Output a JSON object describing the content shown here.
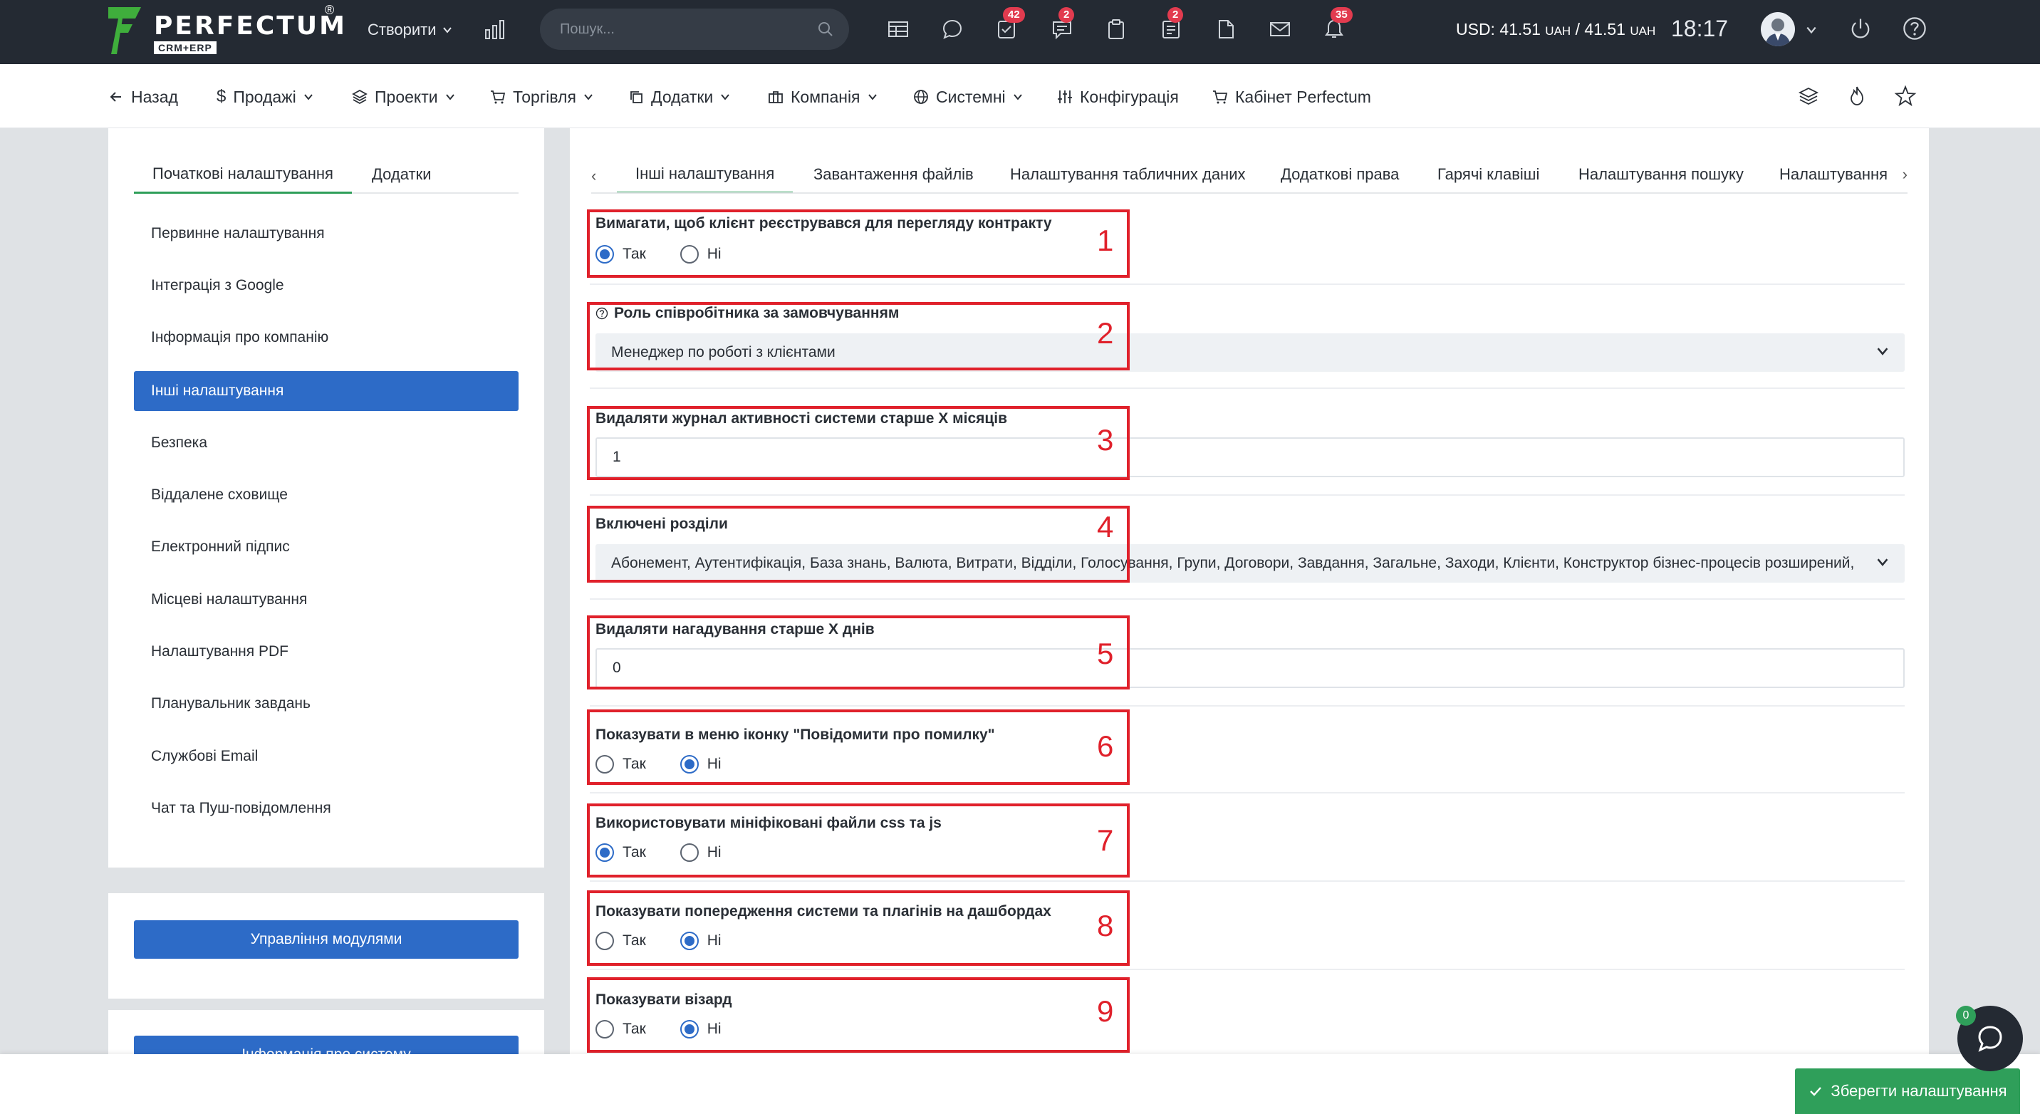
{
  "topbar": {
    "logo_text": "PERFECTUM",
    "logo_reg": "®",
    "logo_sub": "CRM+ERP",
    "create_label": "Створити",
    "search_placeholder": "Пошук...",
    "badges": {
      "tasks": "42",
      "chat": "2",
      "notes": "2",
      "notifications": "35"
    },
    "currency_usd": "USD: 41.51",
    "currency_unit1": "UAH",
    "currency_sep": " / 41.51",
    "currency_unit2": "UAH",
    "time": "18:17"
  },
  "nav2": {
    "back": "Назад",
    "sales": "Продажі",
    "projects": "Проекти",
    "trade": "Торгівля",
    "addons": "Додатки",
    "company": "Компанія",
    "system": "Системні",
    "config": "Конфігурація",
    "cabinet": "Кабінет Perfectum"
  },
  "left": {
    "tab_initial": "Початкові налаштування",
    "tab_addons": "Додатки",
    "items": [
      "Первинне налаштування",
      "Інтеграція з Google",
      "Інформація про компанію",
      "Інші налаштування",
      "Безпека",
      "Віддалене сховище",
      "Електронний підпис",
      "Місцеві налаштування",
      "Налаштування PDF",
      "Планувальник завдань",
      "Службові Email",
      "Чат та Пуш-повідомлення"
    ],
    "active_index": 3,
    "modules_button": "Управління модулями",
    "sysinfo_button": "Інформація про систему"
  },
  "right": {
    "tabs": [
      "Інші налаштування",
      "Завантаження файлів",
      "Налаштування табличних даних",
      "Додаткові права",
      "Гарячі клавіші",
      "Налаштування пошуку",
      "Налаштування"
    ],
    "yes": "Так",
    "no": "Ні",
    "f1_label": "Вимагати, щоб клієнт реєструвався для перегляду контракту",
    "f2_label": "Роль співробітника за замовчуванням",
    "f2_value": "Менеджер по роботі з клієнтами",
    "f3_label": "Видаляти журнал активності системи старше X місяців",
    "f3_value": "1",
    "f4_label": "Включені розділи",
    "f4_value": "Абонемент, Аутентифікація, База знань, Валюта, Витрати, Відділи, Голосування, Групи, Договори, Завдання, Загальне, Заходи, Клієнти, Конструктор бізнес-процесів розширений,",
    "f5_label": "Видаляти нагадування старше X днів",
    "f5_value": "0",
    "f6_label": "Показувати в меню іконку \"Повідомити про помилку\"",
    "f7_label": "Використовувати мініфіковані файли css та js",
    "f8_label": "Показувати попередження системи та плагінів на дашбордах",
    "f9_label": "Показувати візард",
    "markers": [
      "1",
      "2",
      "3",
      "4",
      "5",
      "6",
      "7",
      "8",
      "9"
    ]
  },
  "footer": {
    "save": "Зберегти налаштування",
    "chat_badge": "0"
  },
  "colors": {
    "topbar_bg": "#242a33",
    "accent_blue": "#2d6bc7",
    "accent_green": "#2f9f5a",
    "badge_red": "#e23b4f",
    "annotation_red": "#e0212b"
  }
}
